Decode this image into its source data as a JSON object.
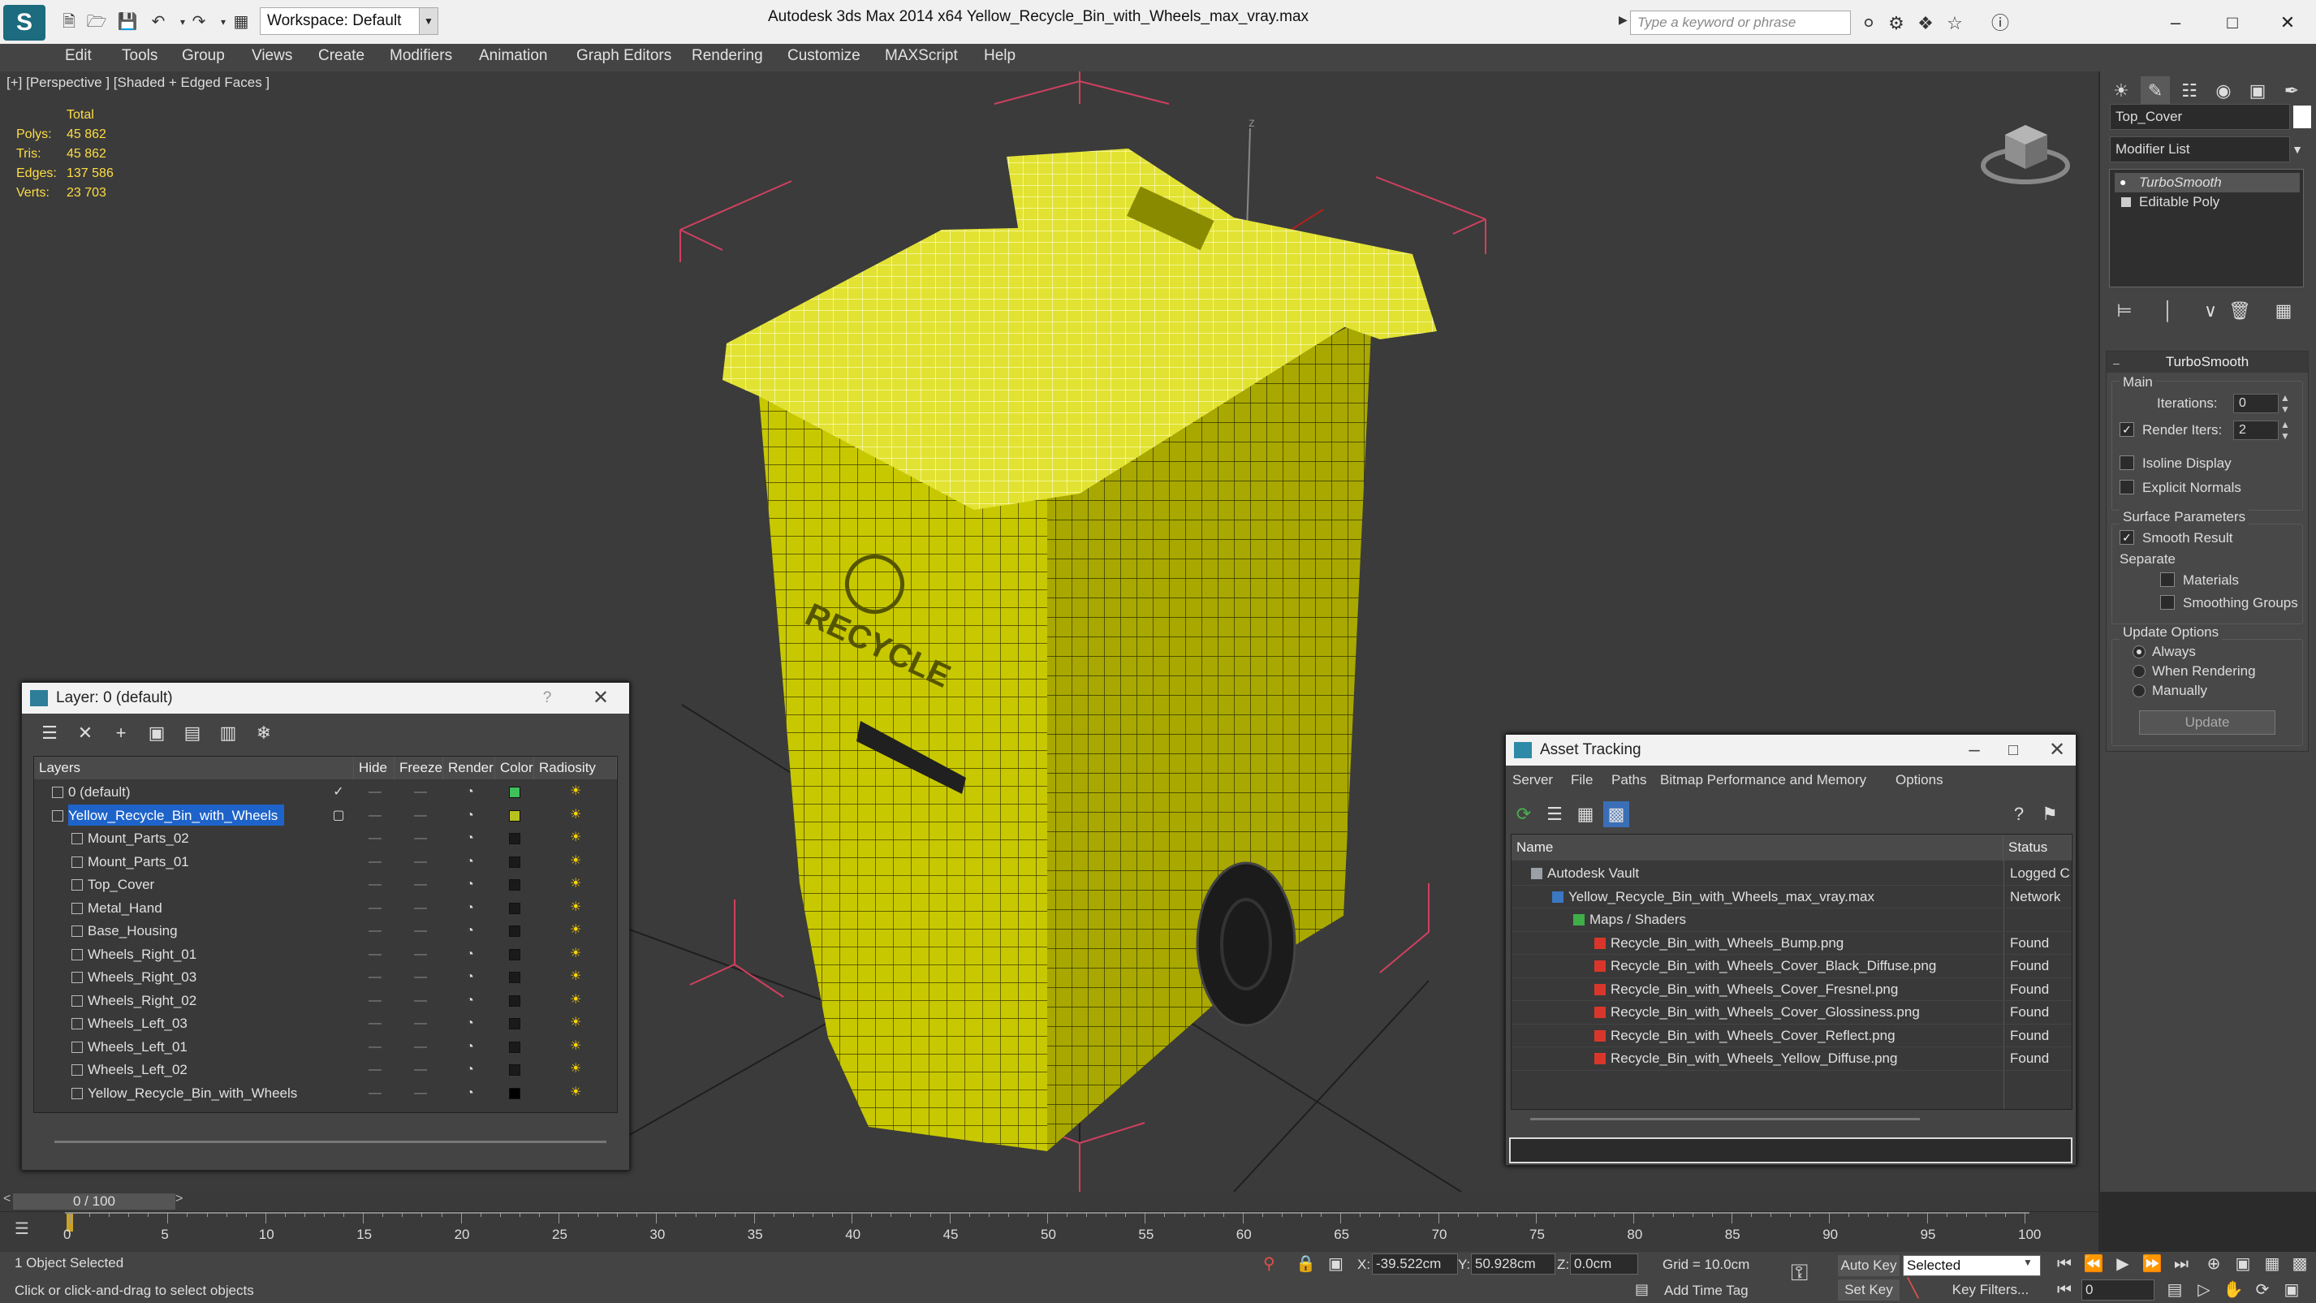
{
  "titlebar": {
    "app_logo": "S",
    "workspace": "Workspace: Default",
    "title": "Autodesk 3ds Max  2014 x64      Yellow_Recycle_Bin_with_Wheels_max_vray.max",
    "search_placeholder": "Type a keyword or phrase"
  },
  "menubar": [
    "Edit",
    "Tools",
    "Group",
    "Views",
    "Create",
    "Modifiers",
    "Animation",
    "Graph Editors",
    "Rendering",
    "Customize",
    "MAXScript",
    "Help"
  ],
  "viewport": {
    "label": "[+] [Perspective ] [Shaded + Edged Faces ]",
    "stats": {
      "header": "Total",
      "polys_label": "Polys:",
      "polys": "45 862",
      "tris_label": "Tris:",
      "tris": "45 862",
      "edges_label": "Edges:",
      "edges": "137 586",
      "verts_label": "Verts:",
      "verts": "23 703"
    },
    "embossed_text": "RECYCLE"
  },
  "command_panel": {
    "object_name": "Top_Cover",
    "modifier_list": "Modifier List",
    "stack": [
      "TurboSmooth",
      "Editable Poly"
    ],
    "turbosmooth": {
      "title": "TurboSmooth",
      "main": "Main",
      "iterations_label": "Iterations:",
      "iterations": "0",
      "render_iters_label": "Render Iters:",
      "render_iters": "2",
      "isoline": "Isoline Display",
      "explicit_normals": "Explicit Normals",
      "surface_params": "Surface Parameters",
      "smooth_result": "Smooth Result",
      "separate": "Separate",
      "materials": "Materials",
      "smoothing_groups": "Smoothing Groups",
      "update_options": "Update Options",
      "always": "Always",
      "when_rendering": "When Rendering",
      "manually": "Manually",
      "update_button": "Update"
    }
  },
  "layer_dialog": {
    "title": "Layer: 0 (default)",
    "help": "?",
    "columns": [
      "Layers",
      "Hide",
      "Freeze",
      "Render",
      "Color",
      "Radiosity"
    ],
    "rows": [
      {
        "name": "0 (default)",
        "color": "#3ec15a",
        "level": 0
      },
      {
        "name": "Yellow_Recycle_Bin_with_Wheels",
        "color": "#b7c21e",
        "level": 0,
        "selected": true
      },
      {
        "name": "Mount_Parts_02",
        "color": "#1a1a1a",
        "level": 1
      },
      {
        "name": "Mount_Parts_01",
        "color": "#1a1a1a",
        "level": 1
      },
      {
        "name": "Top_Cover",
        "color": "#1a1a1a",
        "level": 1
      },
      {
        "name": "Metal_Hand",
        "color": "#1a1a1a",
        "level": 1
      },
      {
        "name": "Base_Housing",
        "color": "#1a1a1a",
        "level": 1
      },
      {
        "name": "Wheels_Right_01",
        "color": "#1a1a1a",
        "level": 1
      },
      {
        "name": "Wheels_Right_03",
        "color": "#1a1a1a",
        "level": 1
      },
      {
        "name": "Wheels_Right_02",
        "color": "#1a1a1a",
        "level": 1
      },
      {
        "name": "Wheels_Left_03",
        "color": "#1a1a1a",
        "level": 1
      },
      {
        "name": "Wheels_Left_01",
        "color": "#1a1a1a",
        "level": 1
      },
      {
        "name": "Wheels_Left_02",
        "color": "#1a1a1a",
        "level": 1
      },
      {
        "name": "Yellow_Recycle_Bin_with_Wheels",
        "color": "#000000",
        "level": 1
      }
    ]
  },
  "asset_dialog": {
    "title": "Asset Tracking",
    "menu": [
      "Server",
      "File",
      "Paths",
      "Bitmap Performance and Memory",
      "Options"
    ],
    "columns": [
      "Name",
      "Status"
    ],
    "rows": [
      {
        "name": "Autodesk Vault",
        "status": "Logged C",
        "level": 0,
        "icon": "vault"
      },
      {
        "name": "Yellow_Recycle_Bin_with_Wheels_max_vray.max",
        "status": "Network",
        "level": 1,
        "icon": "max"
      },
      {
        "name": "Maps / Shaders",
        "status": "",
        "level": 2,
        "icon": "maps"
      },
      {
        "name": "Recycle_Bin_with_Wheels_Bump.png",
        "status": "Found",
        "level": 3,
        "icon": "png"
      },
      {
        "name": "Recycle_Bin_with_Wheels_Cover_Black_Diffuse.png",
        "status": "Found",
        "level": 3,
        "icon": "png"
      },
      {
        "name": "Recycle_Bin_with_Wheels_Cover_Fresnel.png",
        "status": "Found",
        "level": 3,
        "icon": "png"
      },
      {
        "name": "Recycle_Bin_with_Wheels_Cover_Glossiness.png",
        "status": "Found",
        "level": 3,
        "icon": "png"
      },
      {
        "name": "Recycle_Bin_with_Wheels_Cover_Reflect.png",
        "status": "Found",
        "level": 3,
        "icon": "png"
      },
      {
        "name": "Recycle_Bin_with_Wheels_Yellow_Diffuse.png",
        "status": "Found",
        "level": 3,
        "icon": "png"
      }
    ]
  },
  "timeline": {
    "frame": "0 / 100",
    "prev": "<",
    "next": ">",
    "ticks": [
      "0",
      "5",
      "10",
      "15",
      "20",
      "25",
      "30",
      "35",
      "40",
      "45",
      "50",
      "55",
      "60",
      "65",
      "70",
      "75",
      "80",
      "85",
      "90",
      "95",
      "100"
    ]
  },
  "statusbar": {
    "selection": "1 Object Selected",
    "prompt": "Click or click-and-drag to select objects",
    "x_label": "X:",
    "x": "-39.522cm",
    "y_label": "Y:",
    "y": "50.928cm",
    "z_label": "Z:",
    "z": "0.0cm",
    "grid": "Grid = 10.0cm",
    "add_time_tag": "Add Time Tag",
    "auto_key": "Auto Key",
    "set_key": "Set Key",
    "selected": "Selected",
    "key_filters": "Key Filters...",
    "current_frame": "0"
  },
  "colors": {
    "bin_yellow": "#d4d400",
    "selection_blue": "#1e63c9",
    "stats_yellow": "#ffdd44"
  }
}
